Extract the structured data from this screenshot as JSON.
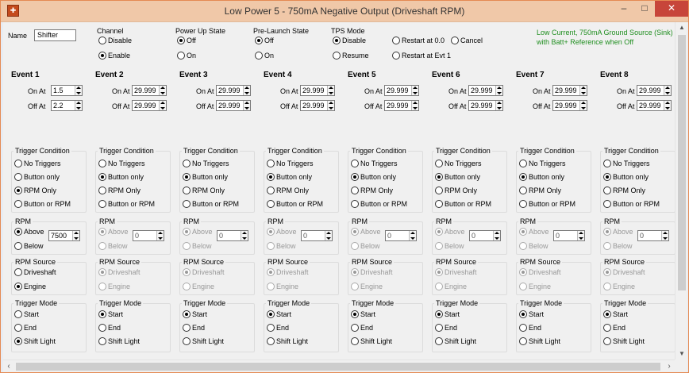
{
  "window": {
    "title": "Low Power 5 - 750mA Negative Output (Driveshaft RPM)",
    "min_label": "–",
    "max_label": "□",
    "close_label": "✕"
  },
  "name": {
    "label": "Name",
    "value": "Shifter"
  },
  "channel": {
    "title": "Channel",
    "disable": "Disable",
    "enable": "Enable",
    "selected": "enable"
  },
  "power_up": {
    "title": "Power Up State",
    "off": "Off",
    "on": "On",
    "selected": "off"
  },
  "pre_launch": {
    "title": "Pre-Launch State",
    "off": "Off",
    "on": "On",
    "selected": "off"
  },
  "tps_mode": {
    "title": "TPS Mode",
    "disable": "Disable",
    "resume": "Resume",
    "restart_00": "Restart at 0.0",
    "restart_evt1": "Restart at Evt 1",
    "cancel": "Cancel",
    "selected": "disable"
  },
  "note": "Low Current, 750mA Ground Source (Sink) with Batt+ Reference when Off",
  "labels": {
    "on_at": "On At",
    "off_at": "Off At",
    "trigger_condition": "Trigger Condition",
    "no_triggers": "No Triggers",
    "button_only": "Button only",
    "rpm_only": "RPM Only",
    "button_or_rpm": "Button or RPM",
    "rpm": "RPM",
    "above": "Above",
    "below": "Below",
    "rpm_source": "RPM Source",
    "driveshaft": "Driveshaft",
    "engine": "Engine",
    "trigger_mode": "Trigger Mode",
    "start": "Start",
    "end": "End",
    "shift_light": "Shift Light"
  },
  "events": [
    {
      "title": "Event 1",
      "on_at": "1.5",
      "off_at": "2.2",
      "trigger": "rpm_only",
      "rpm_dir": "above",
      "rpm_value": "7500",
      "rpm_enabled": true,
      "source": "engine",
      "mode": "shift_light"
    },
    {
      "title": "Event 2",
      "on_at": "29.999",
      "off_at": "29.999",
      "trigger": "button_only",
      "rpm_dir": "above",
      "rpm_value": "0",
      "rpm_enabled": false,
      "source": "driveshaft",
      "mode": "start"
    },
    {
      "title": "Event 3",
      "on_at": "29.999",
      "off_at": "29.999",
      "trigger": "button_only",
      "rpm_dir": "above",
      "rpm_value": "0",
      "rpm_enabled": false,
      "source": "driveshaft",
      "mode": "start"
    },
    {
      "title": "Event 4",
      "on_at": "29.999",
      "off_at": "29.999",
      "trigger": "button_only",
      "rpm_dir": "above",
      "rpm_value": "0",
      "rpm_enabled": false,
      "source": "driveshaft",
      "mode": "start"
    },
    {
      "title": "Event 5",
      "on_at": "29.999",
      "off_at": "29.999",
      "trigger": "button_only",
      "rpm_dir": "above",
      "rpm_value": "0",
      "rpm_enabled": false,
      "source": "driveshaft",
      "mode": "start"
    },
    {
      "title": "Event 6",
      "on_at": "29.999",
      "off_at": "29.999",
      "trigger": "button_only",
      "rpm_dir": "above",
      "rpm_value": "0",
      "rpm_enabled": false,
      "source": "driveshaft",
      "mode": "start"
    },
    {
      "title": "Event 7",
      "on_at": "29.999",
      "off_at": "29.999",
      "trigger": "button_only",
      "rpm_dir": "above",
      "rpm_value": "0",
      "rpm_enabled": false,
      "source": "driveshaft",
      "mode": "start"
    },
    {
      "title": "Event 8",
      "on_at": "29.999",
      "off_at": "29.999",
      "trigger": "button_only",
      "rpm_dir": "above",
      "rpm_value": "0",
      "rpm_enabled": false,
      "source": "driveshaft",
      "mode": "start"
    }
  ]
}
